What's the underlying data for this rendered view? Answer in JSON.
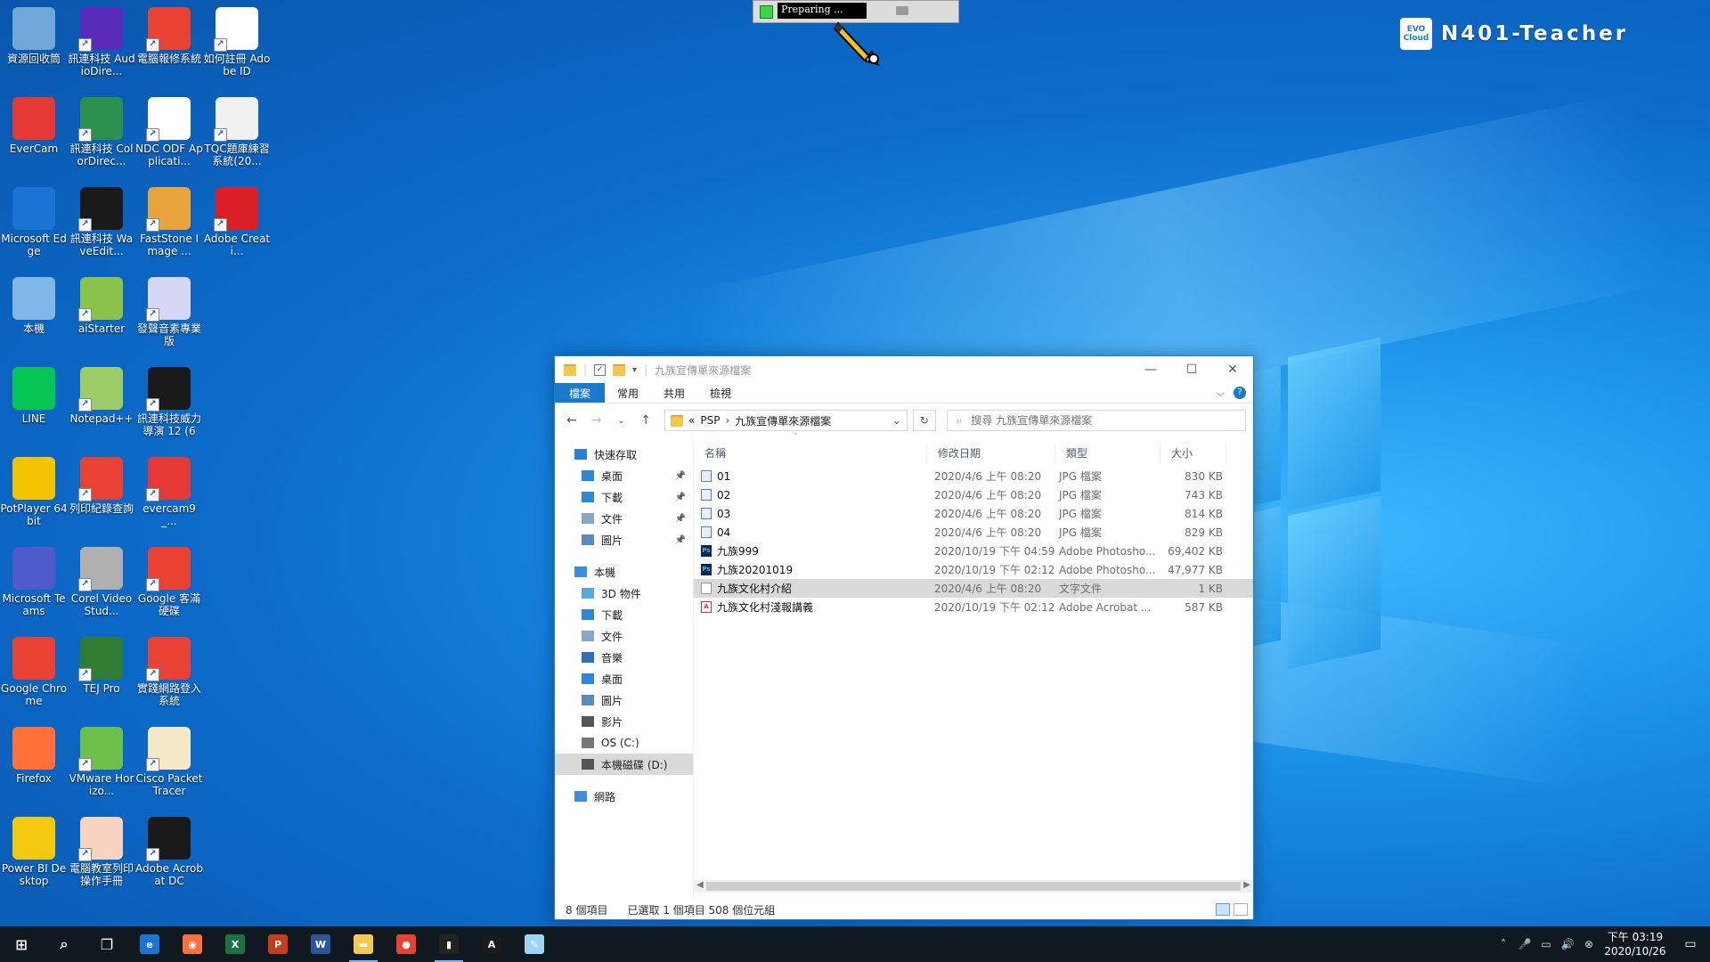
{
  "desktop_icons": [
    {
      "label": "資源回收筒",
      "icon": "recycle-bin-icon",
      "color": "#6fa8d8",
      "short": false
    },
    {
      "label": "訊連科技 AudioDire...",
      "icon": "audiodirector-icon",
      "color": "#5a2ab8",
      "short": true
    },
    {
      "label": "電腦報修系統",
      "icon": "chrome-icon",
      "color": "#e94235",
      "short": true
    },
    {
      "label": "如何註冊 Adobe ID",
      "icon": "pdf-icon",
      "color": "#ffffff",
      "short": true
    },
    {
      "label": "EverCam",
      "icon": "evercam-icon",
      "color": "#e53935",
      "short": false
    },
    {
      "label": "訊連科技 ColorDirec...",
      "icon": "colordirector-icon",
      "color": "#2b8f4e",
      "short": true
    },
    {
      "label": "NDC ODF Applicati...",
      "icon": "document-icon",
      "color": "#ffffff",
      "short": true
    },
    {
      "label": "TQC題庫練習系統(20...",
      "icon": "tqc-icon",
      "color": "#f0f0f0",
      "short": true
    },
    {
      "label": "Microsoft Edge",
      "icon": "edge-icon",
      "color": "#1b74d4",
      "short": false
    },
    {
      "label": "訊連科技 WaveEdit...",
      "icon": "waveeditor-icon",
      "color": "#1a1a1a",
      "short": true
    },
    {
      "label": "FastStone Image ...",
      "icon": "faststone-icon",
      "color": "#e8a33a",
      "short": true
    },
    {
      "label": "Adobe Creati...",
      "icon": "creative-cloud-icon",
      "color": "#da1f26",
      "short": true
    },
    {
      "label": "本機",
      "icon": "this-pc-icon",
      "color": "#7fb7e6",
      "short": false
    },
    {
      "label": "aiStarter",
      "icon": "aistarter-icon",
      "color": "#8bc34a",
      "short": true
    },
    {
      "label": "發聲音素專業版",
      "icon": "phonics-icon",
      "color": "#d6d6f5",
      "short": true
    },
    {
      "label": "LINE",
      "icon": "line-icon",
      "color": "#06c755",
      "short": false
    },
    {
      "label": "Notepad++",
      "icon": "notepadpp-icon",
      "color": "#9ccc65",
      "short": true
    },
    {
      "label": "訊連科技威力導演 12 (64...",
      "icon": "powerdirector-icon",
      "color": "#1a1a1a",
      "short": true
    },
    {
      "label": "PotPlayer 64 bit",
      "icon": "potplayer-icon",
      "color": "#f5c400",
      "short": false
    },
    {
      "label": "列印紀錄查詢",
      "icon": "chrome-icon",
      "color": "#e94235",
      "short": true
    },
    {
      "label": "evercam9_...",
      "icon": "evercam-icon",
      "color": "#e53935",
      "short": true
    },
    {
      "label": "Microsoft Teams",
      "icon": "teams-icon",
      "color": "#5059c9",
      "short": false
    },
    {
      "label": "Corel VideoStud...",
      "icon": "corel-icon",
      "color": "#b0b0b0",
      "short": true
    },
    {
      "label": "Google 客滿硬碟",
      "icon": "chrome-icon",
      "color": "#e94235",
      "short": true
    },
    {
      "label": "Google Chrome",
      "icon": "chrome-icon",
      "color": "#e94235",
      "short": false
    },
    {
      "label": "TEJ Pro",
      "icon": "tej-icon",
      "color": "#2e7d32",
      "short": true
    },
    {
      "label": "實踐網路登入系統",
      "icon": "chrome-icon",
      "color": "#e94235",
      "short": true
    },
    {
      "label": "Firefox",
      "icon": "firefox-icon",
      "color": "#ff7139",
      "short": false
    },
    {
      "label": "VMware Horizo...",
      "icon": "vmware-icon",
      "color": "#6bbf4a",
      "short": true
    },
    {
      "label": "Cisco Packet Tracer",
      "icon": "packet-tracer-icon",
      "color": "#f5e9c8",
      "short": true
    },
    {
      "label": "Power BI Desktop",
      "icon": "powerbi-icon",
      "color": "#f2c811",
      "short": false
    },
    {
      "label": "電腦教室列印操作手冊",
      "icon": "manual-icon",
      "color": "#f6d4c0",
      "short": true
    },
    {
      "label": "Adobe Acrobat DC",
      "icon": "acrobat-icon",
      "color": "#1a1a1a",
      "short": true
    }
  ],
  "recorder_widget": {
    "status": "Preparing ...",
    "camera_icon": "camera-icon"
  },
  "brand": {
    "logo_text": "EVO Cloud",
    "machine_name": "N401-Teacher"
  },
  "explorer": {
    "window_title": "九族宣傳單來源檔案",
    "ribbon_tabs": [
      "檔案",
      "常用",
      "共用",
      "檢視"
    ],
    "breadcrumb": {
      "overflow": "«",
      "parts": [
        "PSP",
        "九族宣傳單來源檔案"
      ]
    },
    "search_placeholder": "搜尋 九族宣傳單來源檔案",
    "nav": [
      {
        "label": "快速存取",
        "icon": "star-icon",
        "indent": 0,
        "pinned": false,
        "selected": false
      },
      {
        "label": "桌面",
        "icon": "desktop-icon",
        "indent": 1,
        "pinned": true,
        "selected": false
      },
      {
        "label": "下載",
        "icon": "download-icon",
        "indent": 1,
        "pinned": true,
        "selected": false
      },
      {
        "label": "文件",
        "icon": "documents-icon",
        "indent": 1,
        "pinned": true,
        "selected": false
      },
      {
        "label": "圖片",
        "icon": "pictures-icon",
        "indent": 1,
        "pinned": true,
        "selected": false
      },
      {
        "label": "",
        "icon": "",
        "indent": 0,
        "pinned": false,
        "selected": false,
        "spacer": true
      },
      {
        "label": "本機",
        "icon": "this-pc-icon",
        "indent": 0,
        "pinned": false,
        "selected": false
      },
      {
        "label": "3D 物件",
        "icon": "3d-objects-icon",
        "indent": 1,
        "pinned": false,
        "selected": false
      },
      {
        "label": "下載",
        "icon": "download-icon",
        "indent": 1,
        "pinned": false,
        "selected": false
      },
      {
        "label": "文件",
        "icon": "documents-icon",
        "indent": 1,
        "pinned": false,
        "selected": false
      },
      {
        "label": "音樂",
        "icon": "music-icon",
        "indent": 1,
        "pinned": false,
        "selected": false
      },
      {
        "label": "桌面",
        "icon": "desktop-icon",
        "indent": 1,
        "pinned": false,
        "selected": false
      },
      {
        "label": "圖片",
        "icon": "pictures-icon",
        "indent": 1,
        "pinned": false,
        "selected": false
      },
      {
        "label": "影片",
        "icon": "videos-icon",
        "indent": 1,
        "pinned": false,
        "selected": false
      },
      {
        "label": "OS (C:)",
        "icon": "drive-c-icon",
        "indent": 1,
        "pinned": false,
        "selected": false
      },
      {
        "label": "本機磁碟 (D:)",
        "icon": "drive-d-icon",
        "indent": 1,
        "pinned": false,
        "selected": true
      },
      {
        "label": "",
        "icon": "",
        "indent": 0,
        "pinned": false,
        "selected": false,
        "spacer": true
      },
      {
        "label": "網路",
        "icon": "network-icon",
        "indent": 0,
        "pinned": false,
        "selected": false
      }
    ],
    "columns": [
      "名稱",
      "修改日期",
      "類型",
      "大小"
    ],
    "files": [
      {
        "name": "01",
        "date": "2020/4/6 上午 08:20",
        "type": "JPG 檔案",
        "size": "830 KB",
        "kind": "jpg",
        "selected": false
      },
      {
        "name": "02",
        "date": "2020/4/6 上午 08:20",
        "type": "JPG 檔案",
        "size": "743 KB",
        "kind": "jpg",
        "selected": false
      },
      {
        "name": "03",
        "date": "2020/4/6 上午 08:20",
        "type": "JPG 檔案",
        "size": "814 KB",
        "kind": "jpg",
        "selected": false
      },
      {
        "name": "04",
        "date": "2020/4/6 上午 08:20",
        "type": "JPG 檔案",
        "size": "829 KB",
        "kind": "jpg",
        "selected": false
      },
      {
        "name": "九族999",
        "date": "2020/10/19 下午 04:59",
        "type": "Adobe Photosho...",
        "size": "69,402 KB",
        "kind": "psd",
        "selected": false
      },
      {
        "name": "九族20201019",
        "date": "2020/10/19 下午 02:12",
        "type": "Adobe Photosho...",
        "size": "47,977 KB",
        "kind": "psd",
        "selected": false
      },
      {
        "name": "九族文化村介紹",
        "date": "2020/4/6 上午 08:20",
        "type": "文字文件",
        "size": "1 KB",
        "kind": "txt",
        "selected": true
      },
      {
        "name": "九族文化村淺報講義",
        "date": "2020/10/19 下午 02:12",
        "type": "Adobe Acrobat ...",
        "size": "587 KB",
        "kind": "pdf",
        "selected": false
      }
    ],
    "status": {
      "count": "8 個項目",
      "selection": "已選取 1 個項目  508 個位元組"
    }
  },
  "taskbar": {
    "apps": [
      {
        "name": "start-button",
        "glyph": "⊞",
        "color": "transparent",
        "active": false
      },
      {
        "name": "search-button",
        "glyph": "⌕",
        "color": "transparent",
        "active": false
      },
      {
        "name": "task-view-button",
        "glyph": "❐",
        "color": "transparent",
        "active": false
      },
      {
        "name": "taskbar-edge",
        "glyph": "e",
        "color": "#1b74d4",
        "active": false
      },
      {
        "name": "taskbar-firefox",
        "glyph": "◉",
        "color": "#ff7139",
        "active": false
      },
      {
        "name": "taskbar-excel",
        "glyph": "X",
        "color": "#1d7044",
        "active": false
      },
      {
        "name": "taskbar-powerpoint",
        "glyph": "P",
        "color": "#c43e1c",
        "active": false
      },
      {
        "name": "taskbar-word",
        "glyph": "W",
        "color": "#2b579a",
        "active": false
      },
      {
        "name": "taskbar-file-explorer",
        "glyph": "▬",
        "color": "#f5c84c",
        "active": true
      },
      {
        "name": "taskbar-chrome",
        "glyph": "●",
        "color": "#e94235",
        "active": false
      },
      {
        "name": "taskbar-terminal",
        "glyph": "▮",
        "color": "#222222",
        "active": true
      },
      {
        "name": "taskbar-acrobat",
        "glyph": "A",
        "color": "#1a1a1a",
        "active": false
      },
      {
        "name": "taskbar-notepad",
        "glyph": "✎",
        "color": "#9fd3f5",
        "active": false
      }
    ],
    "tray_icons": [
      "˄",
      "🎤",
      "▭",
      "🔊",
      "⊗"
    ],
    "time": "下午 03:19",
    "date": "2020/10/26"
  }
}
